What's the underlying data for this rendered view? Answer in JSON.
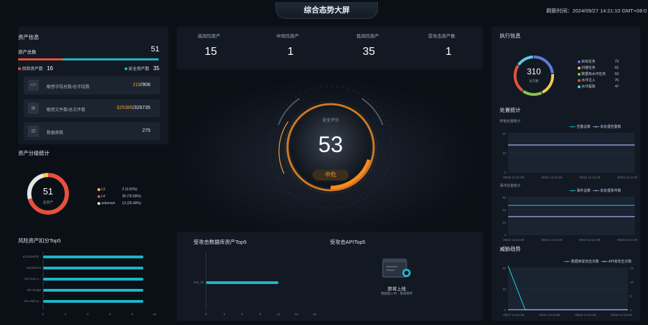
{
  "header": {
    "title": "综合态势大屏",
    "refresh": "刷新时间：2024/09/27 14:21:10 GMT+08:0"
  },
  "asset_info": {
    "title": "资产信息",
    "total_label": "资产总数",
    "total_value": "51",
    "risk_label": "风险资产数",
    "risk_value": "16",
    "safe_label": "安全资产数",
    "safe_value": "35",
    "rows": [
      {
        "label": "敏感字段总数/总字段数",
        "value_hi": "218",
        "value_rest": "/908"
      },
      {
        "label": "敏感文件数/总文件数",
        "value_hi": "325385",
        "value_rest": "/326735"
      },
      {
        "label": "数据表数",
        "value_hi": "",
        "value_rest": "275"
      }
    ]
  },
  "classify": {
    "title": "资产分级统计",
    "center_value": "51",
    "center_label": "总资产",
    "legend": [
      {
        "name": "L3",
        "value": "2  (3.92%)",
        "color": "#f2c94c"
      },
      {
        "name": "L4",
        "value": "36  (70.59%)",
        "color": "#e8503a"
      },
      {
        "name": "unknown",
        "value": "13  (25.49%)",
        "color": "#e6e6e6"
      }
    ]
  },
  "risk_top5": {
    "title": "风险资产扣分Top5",
    "categories": [
      "a1234567b...",
      "autotest12",
      "dm-hive-n...",
      "dm-image",
      "dm-sink-ty..."
    ],
    "x_ticks": [
      "0",
      "2",
      "4",
      "6",
      "8",
      "10"
    ]
  },
  "kpis": [
    {
      "label": "高风险资产",
      "value": "15"
    },
    {
      "label": "中风险资产",
      "value": "1"
    },
    {
      "label": "低风险资产",
      "value": "35"
    },
    {
      "label": "受攻击资产数",
      "value": "1"
    }
  ],
  "score": {
    "label": "安全评分",
    "value": "53",
    "level": "中危"
  },
  "db_top5": {
    "title": "受攻击数据库资产Top5",
    "category": "test_db",
    "x_ticks": [
      "0",
      "3",
      "6",
      "9",
      "12",
      "15",
      "18"
    ]
  },
  "api_top5": {
    "title": "受攻击APITop5",
    "empty_title": "即将上线",
    "empty_sub": "数据接入中，敬请期待"
  },
  "exec": {
    "title": "执行信息",
    "total": "310",
    "total_label": "总次数",
    "legend": [
      {
        "name": "启动任务",
        "value": "73",
        "color": "#5b7cd6"
      },
      {
        "name": "扫描任务",
        "value": "61",
        "color": "#f2c94c"
      },
      {
        "name": "数据库水印任务",
        "value": "53",
        "color": "#8bc34a"
      },
      {
        "name": "水印注入",
        "value": "76",
        "color": "#e8503a"
      },
      {
        "name": "水印提取",
        "value": "47",
        "color": "#5ac8e8"
      }
    ]
  },
  "handle": {
    "title": "处置统计",
    "chart1": {
      "label": "弃管处置统计",
      "legend": [
        "告警总数",
        "未处理告警数"
      ],
      "y_ticks": [
        "0",
        "10",
        "20"
      ]
    },
    "chart2": {
      "label": "事件处置统计",
      "legend": [
        "事件总数",
        "未处理事件数"
      ],
      "y_ticks": [
        "0",
        "20",
        "40",
        "60"
      ]
    },
    "x_ticks": [
      "09/20 14:21:09",
      "09/22 14:21:09",
      "09/24 14:21:09",
      "09/26 14:21:09"
    ]
  },
  "threat": {
    "title": "威胁趋势",
    "legend": [
      "数据库受攻击次数",
      "API受攻击次数"
    ],
    "y_left": [
      "0",
      "10",
      "20"
    ],
    "y_right": [
      "0",
      "5",
      "10",
      "15"
    ],
    "x_ticks": [
      "09/27 14:21:09",
      "09/22 14:21:09",
      "09/24 14:21:09",
      "09/26 14:21:09"
    ]
  },
  "chart_data": [
    {
      "type": "bar",
      "title": "风险资产扣分Top5",
      "categories": [
        "a1234567b...",
        "autotest12",
        "dm-hive-n...",
        "dm-image",
        "dm-sink-ty..."
      ],
      "values": [
        9,
        9,
        9,
        9,
        9
      ],
      "xlim": [
        0,
        10
      ]
    },
    {
      "type": "bar",
      "title": "受攻击数据库资产Top5",
      "categories": [
        "test_db"
      ],
      "values": [
        12
      ],
      "xlim": [
        0,
        18
      ]
    },
    {
      "type": "line",
      "title": "弃管处置统计",
      "series": [
        {
          "name": "告警总数",
          "values": [
            14,
            14,
            14,
            14
          ]
        },
        {
          "name": "未处理告警数",
          "values": [
            14,
            14,
            14,
            14
          ]
        }
      ],
      "ylim": [
        0,
        20
      ]
    },
    {
      "type": "line",
      "title": "事件处置统计",
      "series": [
        {
          "name": "事件总数",
          "values": [
            47,
            47,
            47,
            47
          ]
        },
        {
          "name": "未处理事件数",
          "values": [
            29,
            29,
            29,
            29
          ]
        }
      ],
      "ylim": [
        0,
        60
      ]
    },
    {
      "type": "line",
      "title": "威胁趋势",
      "series": [
        {
          "name": "数据库受攻击次数",
          "values": [
            21,
            0,
            0,
            0,
            0,
            0,
            0,
            0
          ]
        },
        {
          "name": "API受攻击次数",
          "values": [
            0,
            0,
            0,
            0,
            0,
            0,
            0,
            0
          ]
        }
      ],
      "ylim": [
        0,
        20
      ]
    }
  ]
}
